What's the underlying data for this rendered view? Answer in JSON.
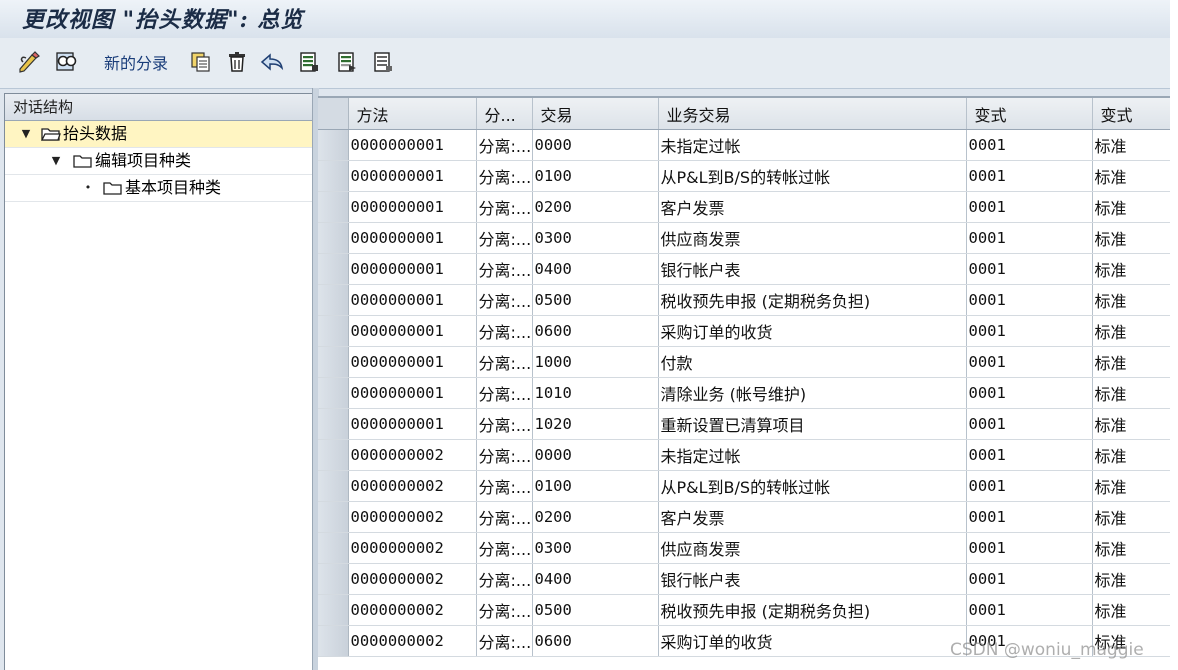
{
  "title": "更改视图 \"抬头数据\": 总览",
  "toolbar": {
    "new_entries_label": "新的分录",
    "icons": [
      "edit-pencil-icon",
      "display-glasses-icon",
      "copy-icon",
      "delete-trash-icon",
      "undo-icon",
      "select-all-icon",
      "select-block-icon",
      "deselect-all-icon"
    ]
  },
  "left_panel": {
    "header": "对话结构",
    "tree": [
      {
        "label": "抬头数据",
        "toggle": "▼",
        "selected": true
      },
      {
        "label": "编辑项目种类",
        "toggle": "▼",
        "selected": false
      },
      {
        "label": "基本项目种类",
        "toggle": "•",
        "selected": false
      }
    ]
  },
  "table": {
    "columns": [
      "方法",
      "分...",
      "交易",
      "业务交易",
      "变式",
      "变式"
    ],
    "rows": [
      [
        "0000000001",
        "分离:...",
        "0000",
        "未指定过帐",
        "0001",
        "标准"
      ],
      [
        "0000000001",
        "分离:...",
        "0100",
        "从P&L到B/S的转帐过帐",
        "0001",
        "标准"
      ],
      [
        "0000000001",
        "分离:...",
        "0200",
        "客户发票",
        "0001",
        "标准"
      ],
      [
        "0000000001",
        "分离:...",
        "0300",
        "供应商发票",
        "0001",
        "标准"
      ],
      [
        "0000000001",
        "分离:...",
        "0400",
        "银行帐户表",
        "0001",
        "标准"
      ],
      [
        "0000000001",
        "分离:...",
        "0500",
        "税收预先申报 (定期税务负担)",
        "0001",
        "标准"
      ],
      [
        "0000000001",
        "分离:...",
        "0600",
        "采购订单的收货",
        "0001",
        "标准"
      ],
      [
        "0000000001",
        "分离:...",
        "1000",
        "付款",
        "0001",
        "标准"
      ],
      [
        "0000000001",
        "分离:...",
        "1010",
        "清除业务 (帐号维护)",
        "0001",
        "标准"
      ],
      [
        "0000000001",
        "分离:...",
        "1020",
        "重新设置已清算项目",
        "0001",
        "标准"
      ],
      [
        "0000000002",
        "分离:...",
        "0000",
        "未指定过帐",
        "0001",
        "标准"
      ],
      [
        "0000000002",
        "分离:...",
        "0100",
        "从P&L到B/S的转帐过帐",
        "0001",
        "标准"
      ],
      [
        "0000000002",
        "分离:...",
        "0200",
        "客户发票",
        "0001",
        "标准"
      ],
      [
        "0000000002",
        "分离:...",
        "0300",
        "供应商发票",
        "0001",
        "标准"
      ],
      [
        "0000000002",
        "分离:...",
        "0400",
        "银行帐户表",
        "0001",
        "标准"
      ],
      [
        "0000000002",
        "分离:...",
        "0500",
        "税收预先申报 (定期税务负担)",
        "0001",
        "标准"
      ],
      [
        "0000000002",
        "分离:...",
        "0600",
        "采购订单的收货",
        "0001",
        "标准"
      ]
    ]
  },
  "watermark": "CSDN @woniu_maggie",
  "colors": {
    "selected_tree_row": "#fff5c2",
    "title_text": "#1b2c46",
    "link_text": "#1a3d7a"
  }
}
